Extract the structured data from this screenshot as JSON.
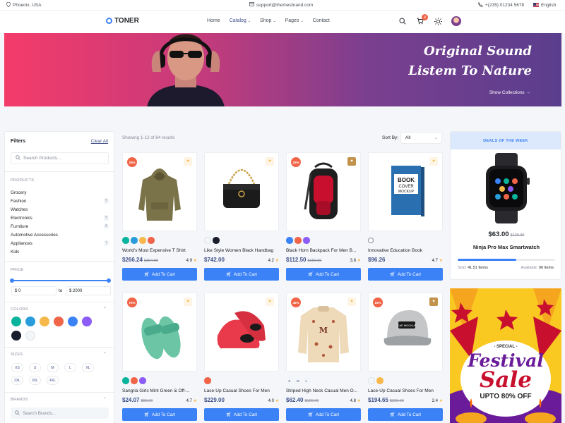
{
  "topbar": {
    "location": "Phoenix, USA",
    "email": "support@themesbrand.com",
    "phone": "+(235) 01234 5678",
    "language": "English"
  },
  "nav": {
    "brand": "TONER",
    "items": [
      {
        "label": "Home",
        "dropdown": false,
        "active": false
      },
      {
        "label": "Catalog",
        "dropdown": true,
        "active": true
      },
      {
        "label": "Shop",
        "dropdown": true,
        "active": false
      },
      {
        "label": "Pages",
        "dropdown": true,
        "active": false
      },
      {
        "label": "Contact",
        "dropdown": false,
        "active": false
      }
    ],
    "cart_count": "4"
  },
  "hero": {
    "line1": "Original Sound",
    "line2": "Listem To Nature",
    "cta": "Show Collections →"
  },
  "filters": {
    "title": "Filters",
    "clear": "Clear All",
    "search_placeholder": "Search Products...",
    "products_title": "PRODUCTS",
    "categories": [
      {
        "label": "Grocery",
        "count": ""
      },
      {
        "label": "Fashion",
        "count": "5"
      },
      {
        "label": "Watches",
        "count": ""
      },
      {
        "label": "Electronics",
        "count": "5"
      },
      {
        "label": "Furniture",
        "count": "6"
      },
      {
        "label": "Automotive Accessories",
        "count": ""
      },
      {
        "label": "Appliances",
        "count": "7"
      },
      {
        "label": "Kids",
        "count": ""
      }
    ],
    "price_title": "PRICE",
    "price_min": "$ 0",
    "price_to": "to",
    "price_max": "$ 2000",
    "colors_title": "COLORS",
    "colors": [
      "#0ab39c",
      "#299cdb",
      "#f7b84b",
      "#f06548",
      "#3b82f6",
      "#8b5cf6",
      "#1a1d2e",
      "#f3f6f9"
    ],
    "sizes_title": "SIZES",
    "sizes": [
      "XS",
      "S",
      "M",
      "L",
      "XL",
      "2XL",
      "3XL",
      "4XL"
    ],
    "brands_title": "BRANDS",
    "brand_placeholder": "Search Brands..."
  },
  "listing": {
    "showing": "Showing 1-12 of 84 results",
    "sort_label": "Sort By:",
    "sort_value": "All"
  },
  "products": [
    {
      "name": "World's Most Expensive T Shirt",
      "price": "$266.24",
      "old": "$354.99",
      "rating": "4.9",
      "discount": "25%",
      "wish_active": false,
      "colors": [
        "#0ab39c",
        "#299cdb",
        "#f7b84b",
        "#f06548"
      ],
      "img": "hoodie"
    },
    {
      "name": "Like Style Women Black Handbag",
      "price": "$742.00",
      "old": "",
      "rating": "4.2",
      "discount": "",
      "wish_active": false,
      "colors": [
        "#f3f6f9",
        "#1a1d2e"
      ],
      "img": "handbag"
    },
    {
      "name": "Black Horn Backpack For Men B...",
      "price": "$112.50",
      "old": "$150.00",
      "rating": "3.8",
      "discount": "25%",
      "wish_active": true,
      "colors": [
        "#3b82f6",
        "#f06548",
        "#8b5cf6"
      ],
      "img": "backpack"
    },
    {
      "name": "Innovative Education Book",
      "price": "$96.26",
      "old": "",
      "rating": "4.7",
      "discount": "",
      "wish_active": false,
      "colors": [],
      "img": "book"
    },
    {
      "name": "Sangria Girls Mint Green & Off-...",
      "price": "$24.07",
      "old": "$90.20",
      "rating": "4.7",
      "discount": "75%",
      "wish_active": false,
      "colors": [
        "#0ab39c",
        "#f06548",
        "#8b5cf6"
      ],
      "img": "slippers"
    },
    {
      "name": "Lace-Up Casual Shoes For Men",
      "price": "$229.00",
      "old": "",
      "rating": "4.0",
      "discount": "",
      "wish_active": false,
      "colors": [
        "#f06548"
      ],
      "img": "shoes"
    },
    {
      "name": "Striped High Neck Casual Men O...",
      "price": "$62.40",
      "old": "$120.00",
      "rating": "4.8",
      "discount": "48%",
      "wish_active": false,
      "colors": [
        "S",
        "M",
        "L"
      ],
      "img": "sweater"
    },
    {
      "name": "Lace-Up Casual Shoes For Men",
      "price": "$194.65",
      "old": "$229.00",
      "rating": "2.4",
      "discount": "15%",
      "wish_active": true,
      "colors": [
        "#f3f6f9",
        "#f7b84b"
      ],
      "img": "cap"
    }
  ],
  "add_to_cart": "Add To Cart",
  "deal": {
    "header": "DEALS OF THE WEEK",
    "price": "$63.00",
    "old": "$129.99",
    "name": "Ninja Pro Max Smartwatch",
    "sold_label": "Sold:",
    "sold": "41.51 Items",
    "avail_label": "Available:",
    "avail": "90 Items",
    "progress": 0.6
  },
  "promo": {
    "kicker": "- SPECIAL -",
    "line1": "Festival",
    "line2": "Sale",
    "line3": "UPTO 80% OFF"
  }
}
